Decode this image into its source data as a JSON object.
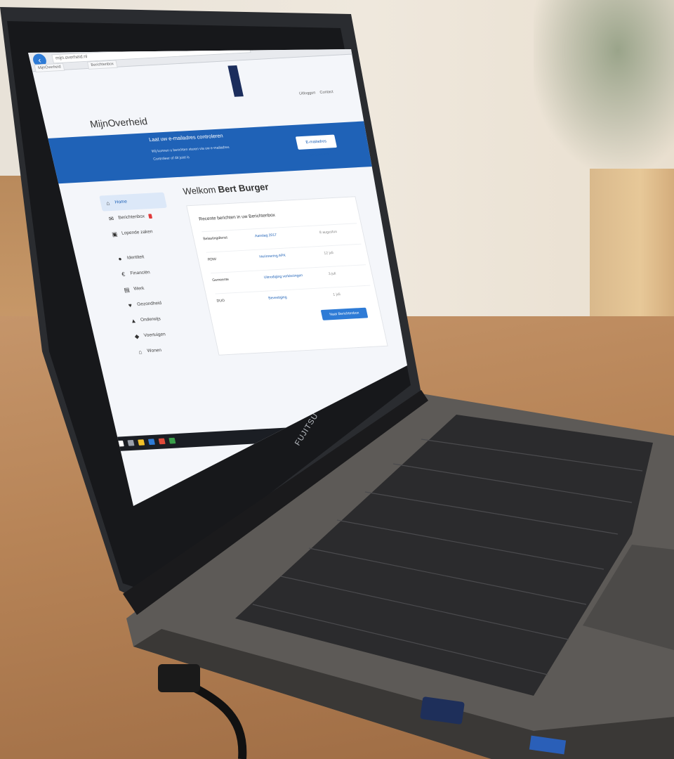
{
  "browser": {
    "back_icon": "back-arrow-icon",
    "url": "mijn.overheid.nl",
    "tabs": [
      "MijnOverheid",
      "Berichtenbox"
    ]
  },
  "site": {
    "brand": "MijnOverheid",
    "top_links": [
      "Uitloggen",
      "Contact"
    ]
  },
  "banner": {
    "title": "Laat uw e-mailadres controleren",
    "line1": "Wij kunnen u berichten sturen via uw e-mailadres",
    "line2": "Controleer of dit juist is",
    "button": "E-mailadres controleren",
    "color": "#1f62b7"
  },
  "sidebar": {
    "items": [
      {
        "label": "Home",
        "icon": "home-icon",
        "active": true
      },
      {
        "label": "Berichtenbox",
        "icon": "envelope-icon",
        "badge": true
      },
      {
        "label": "Lopende zaken",
        "icon": "briefcase-icon"
      },
      {
        "label": "Identiteit",
        "icon": "person-icon"
      },
      {
        "label": "Financiën",
        "icon": "euro-icon"
      },
      {
        "label": "Werk",
        "icon": "building-icon"
      },
      {
        "label": "Gezondheid",
        "icon": "health-icon"
      },
      {
        "label": "Onderwijs",
        "icon": "education-icon"
      },
      {
        "label": "Voertuigen",
        "icon": "car-icon"
      },
      {
        "label": "Wonen",
        "icon": "house-icon"
      }
    ]
  },
  "welcome": {
    "prefix": "Welkom",
    "name": "Bert Burger"
  },
  "card": {
    "title": "Recente berichten in uw Berichtenbox",
    "rows": [
      {
        "from": "Belastingdienst",
        "subject": "Aanslag 2017",
        "date": "8 augustus"
      },
      {
        "from": "RDW",
        "subject": "Herinnering APK",
        "date": "12 juli"
      },
      {
        "from": "Gemeente",
        "subject": "Uitnodiging verkiezingen",
        "date": "3 juli"
      },
      {
        "from": "DUO",
        "subject": "Bevestiging",
        "date": "1 juli"
      }
    ],
    "button": "Naar Berichtenbox"
  },
  "laptop": {
    "brand": "FUJITSU"
  }
}
